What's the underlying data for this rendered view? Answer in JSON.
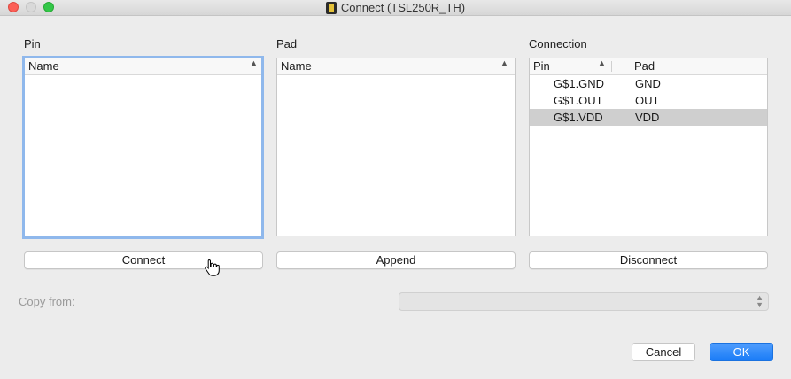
{
  "window": {
    "title": "Connect  (TSL250R_TH)"
  },
  "pin_panel": {
    "label": "Pin",
    "column": "Name",
    "rows": []
  },
  "pad_panel": {
    "label": "Pad",
    "column": "Name",
    "rows": []
  },
  "connection_panel": {
    "label": "Connection",
    "columns": {
      "pin": "Pin",
      "pad": "Pad"
    },
    "rows": [
      {
        "pin": "G$1.GND",
        "pad": "GND",
        "selected": false
      },
      {
        "pin": "G$1.OUT",
        "pad": "OUT",
        "selected": false
      },
      {
        "pin": "G$1.VDD",
        "pad": "VDD",
        "selected": true
      }
    ]
  },
  "buttons": {
    "connect": "Connect",
    "append": "Append",
    "disconnect": "Disconnect",
    "cancel": "Cancel",
    "ok": "OK"
  },
  "copy_from": {
    "label": "Copy from:",
    "value": ""
  },
  "icons": {
    "sort_arrow": "▲",
    "select_arrows": "⌃⌄"
  },
  "colors": {
    "accent": "#1a7cf7",
    "focus_ring": "#8fb8ec",
    "selected_row": "#cfcfcf",
    "background": "#ececec"
  }
}
